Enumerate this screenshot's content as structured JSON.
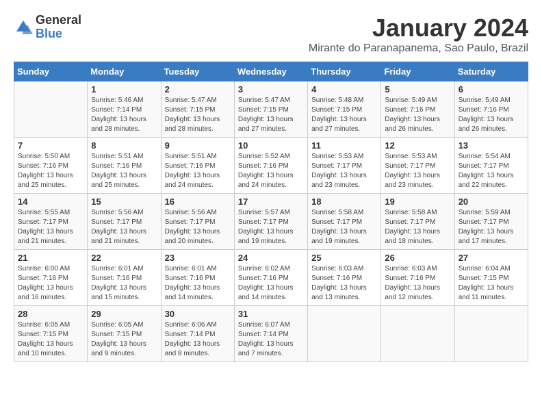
{
  "logo": {
    "general": "General",
    "blue": "Blue"
  },
  "title": "January 2024",
  "location": "Mirante do Paranapanema, Sao Paulo, Brazil",
  "days_header": [
    "Sunday",
    "Monday",
    "Tuesday",
    "Wednesday",
    "Thursday",
    "Friday",
    "Saturday"
  ],
  "weeks": [
    [
      {
        "day": "",
        "sunrise": "",
        "sunset": "",
        "daylight": ""
      },
      {
        "day": "1",
        "sunrise": "Sunrise: 5:46 AM",
        "sunset": "Sunset: 7:14 PM",
        "daylight": "Daylight: 13 hours and 28 minutes."
      },
      {
        "day": "2",
        "sunrise": "Sunrise: 5:47 AM",
        "sunset": "Sunset: 7:15 PM",
        "daylight": "Daylight: 13 hours and 28 minutes."
      },
      {
        "day": "3",
        "sunrise": "Sunrise: 5:47 AM",
        "sunset": "Sunset: 7:15 PM",
        "daylight": "Daylight: 13 hours and 27 minutes."
      },
      {
        "day": "4",
        "sunrise": "Sunrise: 5:48 AM",
        "sunset": "Sunset: 7:15 PM",
        "daylight": "Daylight: 13 hours and 27 minutes."
      },
      {
        "day": "5",
        "sunrise": "Sunrise: 5:49 AM",
        "sunset": "Sunset: 7:16 PM",
        "daylight": "Daylight: 13 hours and 26 minutes."
      },
      {
        "day": "6",
        "sunrise": "Sunrise: 5:49 AM",
        "sunset": "Sunset: 7:16 PM",
        "daylight": "Daylight: 13 hours and 26 minutes."
      }
    ],
    [
      {
        "day": "7",
        "sunrise": "Sunrise: 5:50 AM",
        "sunset": "Sunset: 7:16 PM",
        "daylight": "Daylight: 13 hours and 25 minutes."
      },
      {
        "day": "8",
        "sunrise": "Sunrise: 5:51 AM",
        "sunset": "Sunset: 7:16 PM",
        "daylight": "Daylight: 13 hours and 25 minutes."
      },
      {
        "day": "9",
        "sunrise": "Sunrise: 5:51 AM",
        "sunset": "Sunset: 7:16 PM",
        "daylight": "Daylight: 13 hours and 24 minutes."
      },
      {
        "day": "10",
        "sunrise": "Sunrise: 5:52 AM",
        "sunset": "Sunset: 7:16 PM",
        "daylight": "Daylight: 13 hours and 24 minutes."
      },
      {
        "day": "11",
        "sunrise": "Sunrise: 5:53 AM",
        "sunset": "Sunset: 7:17 PM",
        "daylight": "Daylight: 13 hours and 23 minutes."
      },
      {
        "day": "12",
        "sunrise": "Sunrise: 5:53 AM",
        "sunset": "Sunset: 7:17 PM",
        "daylight": "Daylight: 13 hours and 23 minutes."
      },
      {
        "day": "13",
        "sunrise": "Sunrise: 5:54 AM",
        "sunset": "Sunset: 7:17 PM",
        "daylight": "Daylight: 13 hours and 22 minutes."
      }
    ],
    [
      {
        "day": "14",
        "sunrise": "Sunrise: 5:55 AM",
        "sunset": "Sunset: 7:17 PM",
        "daylight": "Daylight: 13 hours and 21 minutes."
      },
      {
        "day": "15",
        "sunrise": "Sunrise: 5:56 AM",
        "sunset": "Sunset: 7:17 PM",
        "daylight": "Daylight: 13 hours and 21 minutes."
      },
      {
        "day": "16",
        "sunrise": "Sunrise: 5:56 AM",
        "sunset": "Sunset: 7:17 PM",
        "daylight": "Daylight: 13 hours and 20 minutes."
      },
      {
        "day": "17",
        "sunrise": "Sunrise: 5:57 AM",
        "sunset": "Sunset: 7:17 PM",
        "daylight": "Daylight: 13 hours and 19 minutes."
      },
      {
        "day": "18",
        "sunrise": "Sunrise: 5:58 AM",
        "sunset": "Sunset: 7:17 PM",
        "daylight": "Daylight: 13 hours and 19 minutes."
      },
      {
        "day": "19",
        "sunrise": "Sunrise: 5:58 AM",
        "sunset": "Sunset: 7:17 PM",
        "daylight": "Daylight: 13 hours and 18 minutes."
      },
      {
        "day": "20",
        "sunrise": "Sunrise: 5:59 AM",
        "sunset": "Sunset: 7:17 PM",
        "daylight": "Daylight: 13 hours and 17 minutes."
      }
    ],
    [
      {
        "day": "21",
        "sunrise": "Sunrise: 6:00 AM",
        "sunset": "Sunset: 7:16 PM",
        "daylight": "Daylight: 13 hours and 16 minutes."
      },
      {
        "day": "22",
        "sunrise": "Sunrise: 6:01 AM",
        "sunset": "Sunset: 7:16 PM",
        "daylight": "Daylight: 13 hours and 15 minutes."
      },
      {
        "day": "23",
        "sunrise": "Sunrise: 6:01 AM",
        "sunset": "Sunset: 7:16 PM",
        "daylight": "Daylight: 13 hours and 14 minutes."
      },
      {
        "day": "24",
        "sunrise": "Sunrise: 6:02 AM",
        "sunset": "Sunset: 7:16 PM",
        "daylight": "Daylight: 13 hours and 14 minutes."
      },
      {
        "day": "25",
        "sunrise": "Sunrise: 6:03 AM",
        "sunset": "Sunset: 7:16 PM",
        "daylight": "Daylight: 13 hours and 13 minutes."
      },
      {
        "day": "26",
        "sunrise": "Sunrise: 6:03 AM",
        "sunset": "Sunset: 7:16 PM",
        "daylight": "Daylight: 13 hours and 12 minutes."
      },
      {
        "day": "27",
        "sunrise": "Sunrise: 6:04 AM",
        "sunset": "Sunset: 7:15 PM",
        "daylight": "Daylight: 13 hours and 11 minutes."
      }
    ],
    [
      {
        "day": "28",
        "sunrise": "Sunrise: 6:05 AM",
        "sunset": "Sunset: 7:15 PM",
        "daylight": "Daylight: 13 hours and 10 minutes."
      },
      {
        "day": "29",
        "sunrise": "Sunrise: 6:05 AM",
        "sunset": "Sunset: 7:15 PM",
        "daylight": "Daylight: 13 hours and 9 minutes."
      },
      {
        "day": "30",
        "sunrise": "Sunrise: 6:06 AM",
        "sunset": "Sunset: 7:14 PM",
        "daylight": "Daylight: 13 hours and 8 minutes."
      },
      {
        "day": "31",
        "sunrise": "Sunrise: 6:07 AM",
        "sunset": "Sunset: 7:14 PM",
        "daylight": "Daylight: 13 hours and 7 minutes."
      },
      {
        "day": "",
        "sunrise": "",
        "sunset": "",
        "daylight": ""
      },
      {
        "day": "",
        "sunrise": "",
        "sunset": "",
        "daylight": ""
      },
      {
        "day": "",
        "sunrise": "",
        "sunset": "",
        "daylight": ""
      }
    ]
  ]
}
